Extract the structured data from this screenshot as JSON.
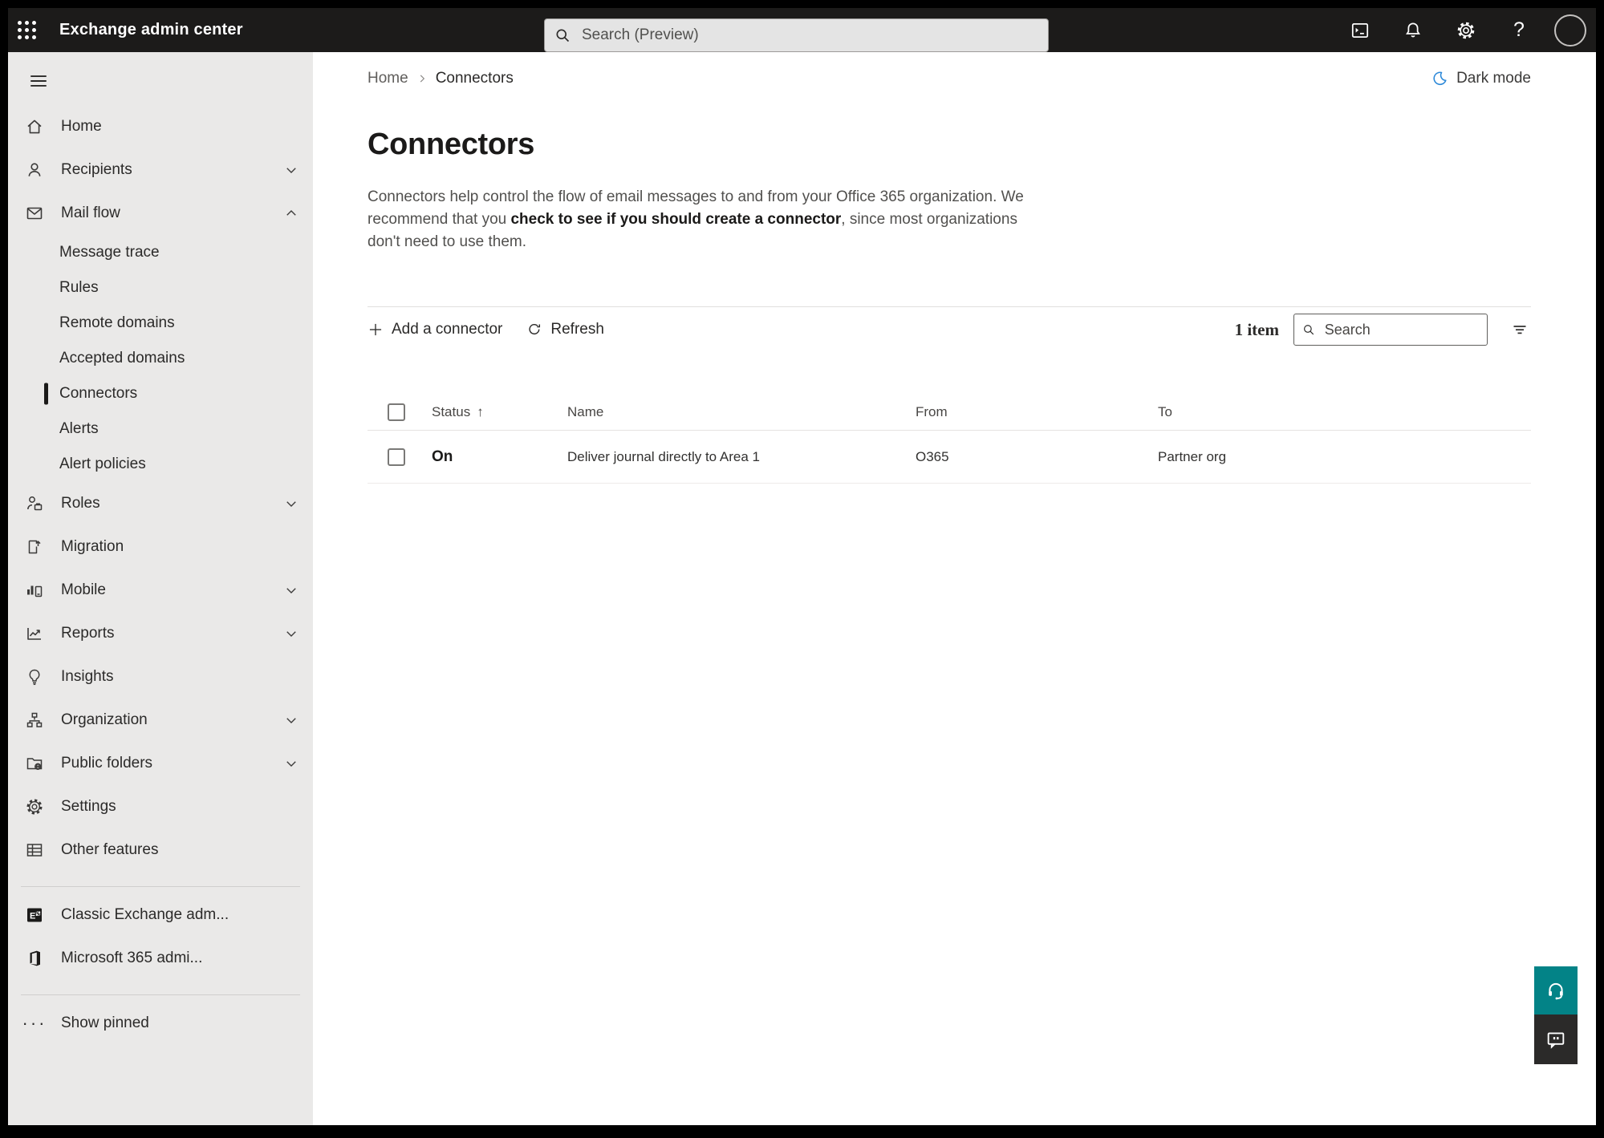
{
  "topbar": {
    "app_title": "Exchange admin center",
    "search_placeholder": "Search (Preview)"
  },
  "sidebar": {
    "items": [
      {
        "label": "Home"
      },
      {
        "label": "Recipients"
      },
      {
        "label": "Mail flow"
      },
      {
        "label": "Roles"
      },
      {
        "label": "Migration"
      },
      {
        "label": "Mobile"
      },
      {
        "label": "Reports"
      },
      {
        "label": "Insights"
      },
      {
        "label": "Organization"
      },
      {
        "label": "Public folders"
      },
      {
        "label": "Settings"
      },
      {
        "label": "Other features"
      }
    ],
    "mail_flow_children": [
      "Message trace",
      "Rules",
      "Remote domains",
      "Accepted domains",
      "Connectors",
      "Alerts",
      "Alert policies"
    ],
    "selected_child": "Connectors",
    "footer_links": [
      "Classic Exchange adm...",
      "Microsoft 365 admi..."
    ],
    "show_pinned": "Show pinned"
  },
  "breadcrumb": {
    "home": "Home",
    "current": "Connectors"
  },
  "dark_mode_label": "Dark mode",
  "page": {
    "title": "Connectors",
    "description_1": "Connectors help control the flow of email messages to and from your Office 365 organization. We recommend that you ",
    "description_link": "check to see if you should create a connector",
    "description_2": ", since most organizations don't need to use them."
  },
  "toolbar": {
    "add_label": "Add a connector",
    "refresh_label": "Refresh",
    "item_count": "1 item",
    "search_placeholder": "Search"
  },
  "table": {
    "headers": {
      "status": "Status",
      "name": "Name",
      "from": "From",
      "to": "To"
    },
    "row": {
      "status": "On",
      "name": "Deliver journal directly to Area 1",
      "from": "O365",
      "to": "Partner org"
    }
  },
  "colors": {
    "topbar": "#1c1b1a",
    "teal": "#038387",
    "moon_blue": "#2b88d8",
    "accent_bar": "#1b1a19"
  }
}
